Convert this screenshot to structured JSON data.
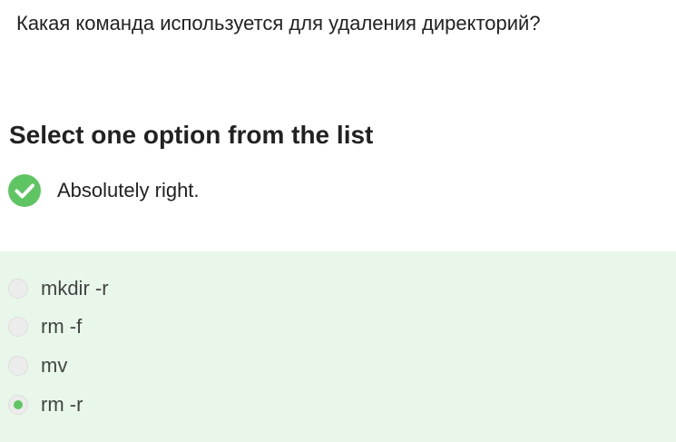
{
  "question": {
    "text": "Какая команда используется для удаления директорий?"
  },
  "instruction": {
    "text": "Select one option from the list"
  },
  "feedback": {
    "icon": "check-circle-icon",
    "text": "Absolutely right.",
    "color": "#5fc562"
  },
  "options_panel": {
    "background": "#e8f7e9",
    "selected_index": 3,
    "options": [
      {
        "label": "mkdir -r",
        "selected": false
      },
      {
        "label": "rm -f",
        "selected": false
      },
      {
        "label": "mv",
        "selected": false
      },
      {
        "label": "rm -r",
        "selected": true
      }
    ]
  }
}
